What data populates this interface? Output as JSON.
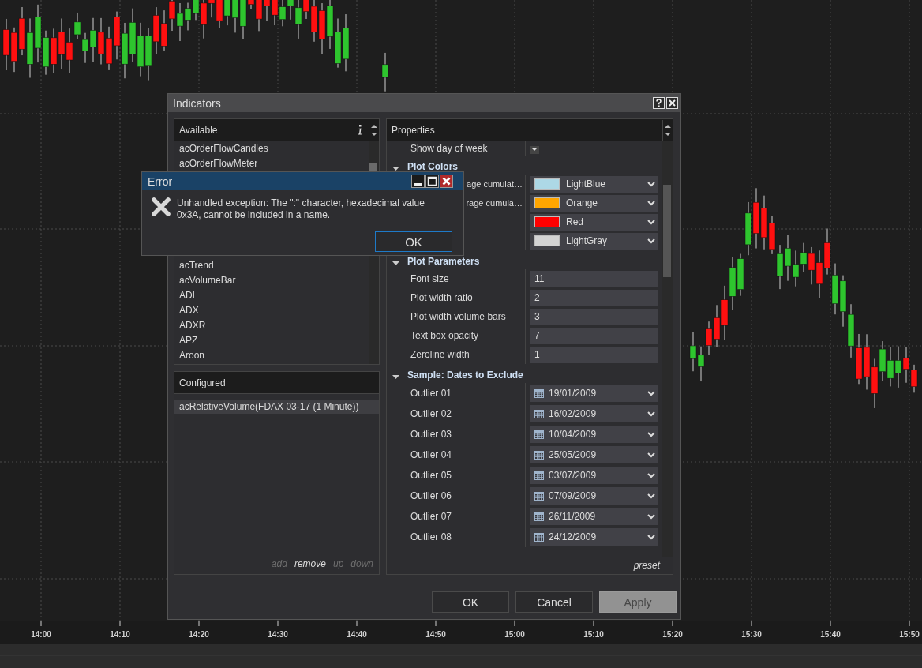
{
  "chart": {
    "time_labels": [
      "14:00",
      "14:10",
      "14:20",
      "14:30",
      "14:40",
      "14:50",
      "15:00",
      "15:10",
      "15:20",
      "15:30",
      "15:40",
      "15:50"
    ]
  },
  "indicators_dialog": {
    "title": "Indicators",
    "available": {
      "header": "Available",
      "items_above": [
        "acOrderFlowCandles",
        "acOrderFlowMeter"
      ],
      "items_below": [
        "acTrend",
        "acVolumeBar",
        "ADL",
        "ADX",
        "ADXR",
        "APZ",
        "Aroon"
      ]
    },
    "configured": {
      "header": "Configured",
      "items": [
        {
          "label": "acRelativeVolume(FDAX 03-17 (1 Minute))",
          "selected": true
        }
      ],
      "actions": [
        {
          "label": "add",
          "disabled": true
        },
        {
          "label": "remove",
          "disabled": false
        },
        {
          "label": "up",
          "disabled": true
        },
        {
          "label": "down",
          "disabled": true
        }
      ]
    },
    "properties": {
      "header": "Properties",
      "sections": [
        {
          "rows": [
            {
              "kind": "toggle",
              "label": "Show day of week"
            }
          ]
        },
        {
          "title": "Plot Colors",
          "expanded": true,
          "rows": [
            {
              "kind": "color",
              "label": "age cumulat…",
              "value": "LightBlue",
              "color": "#add8e6"
            },
            {
              "kind": "color",
              "label": "rage cumula…",
              "value": "Orange",
              "color": "#ffa500"
            },
            {
              "kind": "color",
              "value": "Red",
              "color": "#ff0000"
            },
            {
              "kind": "color",
              "value": "LightGray",
              "color": "#d3d3d3"
            }
          ]
        },
        {
          "title": "Plot Parameters",
          "expanded": true,
          "rows": [
            {
              "kind": "number",
              "label": "Font size",
              "value": "11"
            },
            {
              "kind": "number",
              "label": "Plot width ratio",
              "value": "2"
            },
            {
              "kind": "number",
              "label": "Plot width volume bars",
              "value": "3"
            },
            {
              "kind": "number",
              "label": "Text box opacity",
              "value": "7"
            },
            {
              "kind": "number",
              "label": "Zeroline width",
              "value": "1"
            }
          ]
        },
        {
          "title": "Sample: Dates to Exclude",
          "expanded": true,
          "rows": [
            {
              "kind": "date",
              "label": "Outlier 01",
              "value": "19/01/2009"
            },
            {
              "kind": "date",
              "label": "Outlier 02",
              "value": "16/02/2009"
            },
            {
              "kind": "date",
              "label": "Outlier 03",
              "value": "10/04/2009"
            },
            {
              "kind": "date",
              "label": "Outlier 04",
              "value": "25/05/2009"
            },
            {
              "kind": "date",
              "label": "Outlier 05",
              "value": "03/07/2009"
            },
            {
              "kind": "date",
              "label": "Outlier 06",
              "value": "07/09/2009"
            },
            {
              "kind": "date",
              "label": "Outlier 07",
              "value": "26/11/2009"
            },
            {
              "kind": "date",
              "label": "Outlier 08",
              "value": "24/12/2009"
            }
          ]
        }
      ],
      "preset": "preset"
    },
    "buttons": [
      {
        "label": "OK",
        "disabled": false
      },
      {
        "label": "Cancel",
        "disabled": false
      },
      {
        "label": "Apply",
        "disabled": true
      }
    ]
  },
  "error_dialog": {
    "title": "Error",
    "message": "Unhandled exception: The \":\" character, hexadecimal value 0x3A, cannot be included in a name.",
    "button": {
      "label": "OK",
      "focused": true
    }
  }
}
